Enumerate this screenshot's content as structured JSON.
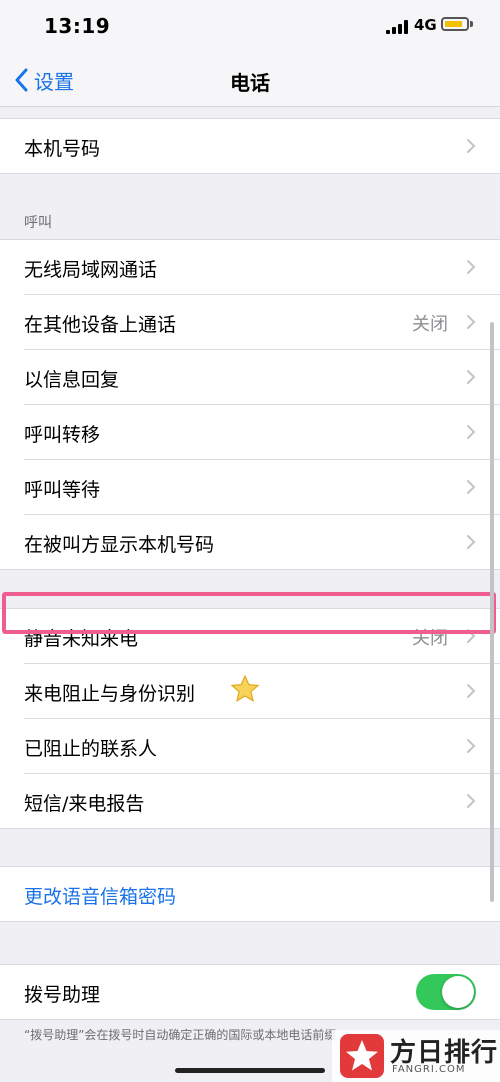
{
  "status_bar": {
    "time": "13:19",
    "network": "4G"
  },
  "nav": {
    "back_label": "设置",
    "title": "电话"
  },
  "my_number": {
    "label": "本机号码"
  },
  "calls": {
    "header": "呼叫",
    "items": [
      {
        "label": "无线局域网通话",
        "value": ""
      },
      {
        "label": "在其他设备上通话",
        "value": "关闭"
      },
      {
        "label": "以信息回复",
        "value": ""
      },
      {
        "label": "呼叫转移",
        "value": ""
      },
      {
        "label": "呼叫等待",
        "value": ""
      },
      {
        "label": "在被叫方显示本机号码",
        "value": ""
      }
    ]
  },
  "blocking": {
    "items": [
      {
        "label": "静音未知来电",
        "value": "关闭"
      },
      {
        "label": "来电阻止与身份识别",
        "value": ""
      },
      {
        "label": "已阻止的联系人",
        "value": ""
      },
      {
        "label": "短信/来电报告",
        "value": ""
      }
    ]
  },
  "voicemail": {
    "label": "更改语音信箱密码"
  },
  "dial_assist": {
    "label": "拨号助理",
    "enabled": true,
    "footer": "“拨号助理”会在拨号时自动确定正确的国际或本地电话前缀"
  },
  "watermark": {
    "title": "方日排行",
    "subtitle": "FANGRI.COM"
  },
  "colors": {
    "accent": "#1a73e8",
    "toggle_on": "#34c759",
    "highlight": "#ee5f8f"
  }
}
